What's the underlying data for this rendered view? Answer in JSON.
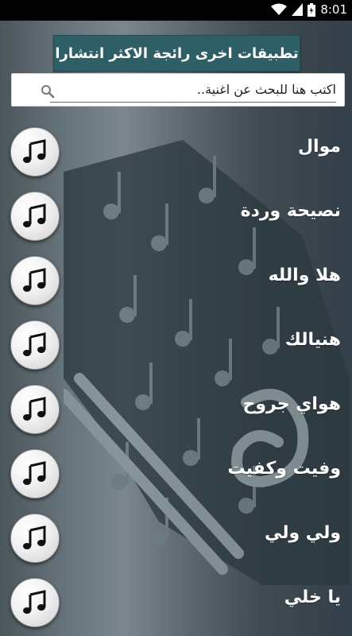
{
  "status_bar": {
    "time": "8:01",
    "icons": [
      "wifi-icon",
      "signal-icon",
      "battery-icon"
    ]
  },
  "banner": {
    "label": "تطبيقات اخرى رائجة الاكثر انتشارا"
  },
  "search": {
    "value": "",
    "placeholder": "اكتب هنا للبحث عن اغنية.."
  },
  "songs": [
    {
      "title": "موال",
      "icon": "music-note-icon"
    },
    {
      "title": "نصيحة وردة",
      "icon": "music-note-icon"
    },
    {
      "title": "هلا والله",
      "icon": "music-note-icon"
    },
    {
      "title": "هنيالك",
      "icon": "music-note-icon"
    },
    {
      "title": "هواي جروح",
      "icon": "music-note-icon"
    },
    {
      "title": "وفيت وكفيت",
      "icon": "music-note-icon"
    },
    {
      "title": "ولي ولي",
      "icon": "music-note-icon"
    },
    {
      "title": "يا خلي",
      "icon": "music-note-icon"
    }
  ],
  "colors": {
    "banner_bg": "#2f5f66",
    "text": "#ffffff",
    "status_bar": "#000000"
  }
}
